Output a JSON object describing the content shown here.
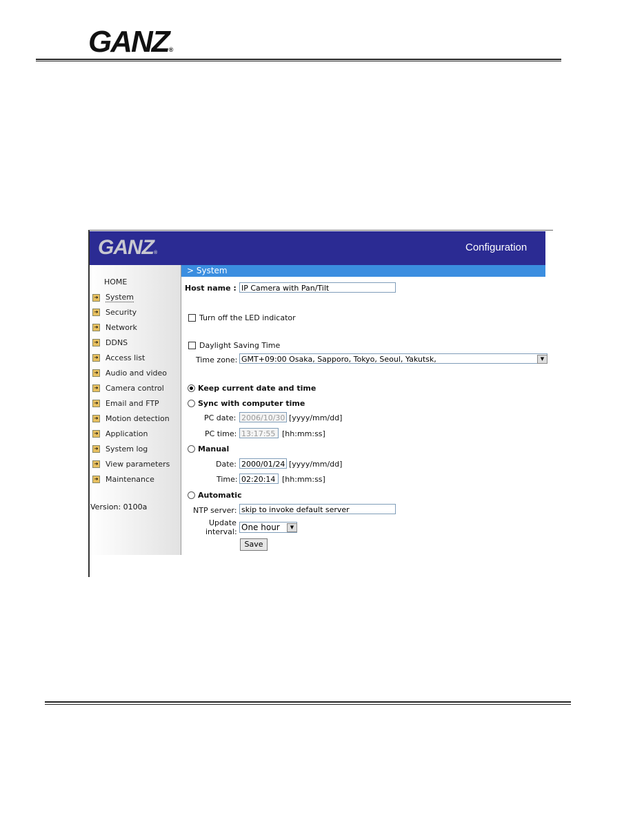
{
  "doc": {
    "logo": "GANZ"
  },
  "app": {
    "logo": "GANZ",
    "title": "Configuration",
    "section": "> System",
    "version": "Version: 0100a",
    "nav": [
      "HOME",
      "System",
      "Security",
      "Network",
      "DDNS",
      "Access list",
      "Audio and video",
      "Camera control",
      "Email and FTP",
      "Motion detection",
      "Application",
      "System log",
      "View parameters",
      "Maintenance"
    ]
  },
  "form": {
    "host_label": "Host name :",
    "host_value": "IP Camera with Pan/Tilt",
    "led_label": "Turn off the LED indicator",
    "led_checked": false,
    "dst_label": "Daylight Saving Time",
    "dst_checked": false,
    "tz_label": "Time zone:",
    "tz_value": "GMT+09:00 Osaka, Sapporo, Tokyo, Seoul, Yakutsk,",
    "keep_label": "Keep current date and time",
    "sync_label": "Sync with computer time",
    "selected_mode": "keep",
    "pcdate_label": "PC date:",
    "pcdate_value": "2006/10/30",
    "date_fmt": "[yyyy/mm/dd]",
    "pctime_label": "PC time:",
    "pctime_value": "13:17:55",
    "time_fmt": "[hh:mm:ss]",
    "manual_label": "Manual",
    "date_label": "Date:",
    "date_value": "2000/01/24",
    "time_label": "Time:",
    "time_value": "02:20:14",
    "auto_label": "Automatic",
    "ntp_label": "NTP server:",
    "ntp_value": "skip to invoke default server",
    "upd_label1": "Update",
    "upd_label2": "interval:",
    "upd_value": "One hour",
    "save": "Save"
  }
}
